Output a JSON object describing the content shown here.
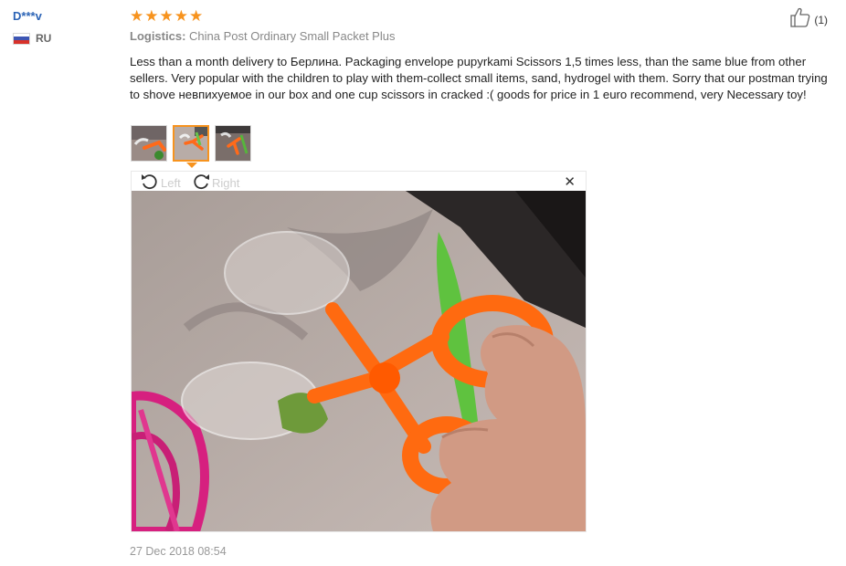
{
  "review": {
    "user": {
      "name": "D***v",
      "country_code": "RU",
      "flag_icon": "russia-flag-icon"
    },
    "rating": {
      "stars": 5,
      "max": 5,
      "color": "#f7931e"
    },
    "logistics": {
      "label": "Logistics:",
      "value": "China Post Ordinary Small Packet Plus"
    },
    "text": "Less than a month delivery to Берлина. Packaging envelope pupyrkami Scissors 1,5 times less, than the same blue from other sellers. Very popular with the children to play with them-collect small items, sand, hydrogel with them. Sorry that our postman trying to shove невпихуемое in our box and one cup scissors in cracked :( goods for price in 1 euro recommend, very Necessary toy!",
    "helpful": {
      "icon": "thumbs-up-icon",
      "count": "(1)"
    },
    "thumbnails": [
      {
        "name": "photo-1",
        "active": false
      },
      {
        "name": "photo-2",
        "active": true
      },
      {
        "name": "photo-3",
        "active": false
      }
    ],
    "viewer": {
      "rotate_left_label": "Left",
      "rotate_right_label": "Right",
      "close_icon": "close-icon",
      "close_glyph": "✕"
    },
    "date": "27 Dec 2018 08:54"
  },
  "colors": {
    "link": "#2c64b6",
    "accent": "#f7931e",
    "meta": "#999999"
  }
}
